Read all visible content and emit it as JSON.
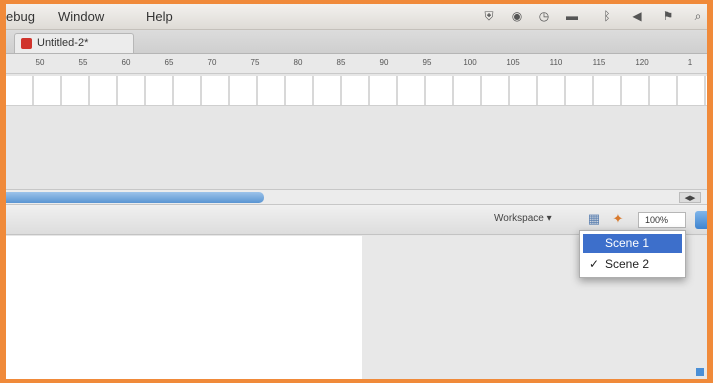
{
  "menubar": {
    "items": [
      "ebug",
      "Window",
      "Help"
    ]
  },
  "document_tab": {
    "label": "Untitled-2*"
  },
  "timeline": {
    "ruler_ticks": [
      "50",
      "55",
      "60",
      "65",
      "70",
      "75",
      "80",
      "85",
      "90",
      "95",
      "100",
      "105",
      "110",
      "115",
      "120",
      "1"
    ]
  },
  "stage_toolbar": {
    "workspace_label": "Workspace ▾",
    "zoom_value": "100%"
  },
  "scene_menu": {
    "items": [
      {
        "label": "Scene 1",
        "checked": false,
        "highlighted": true
      },
      {
        "label": "Scene 2",
        "checked": true,
        "highlighted": false
      }
    ],
    "check_glyph": "✓"
  },
  "colors": {
    "window_border": "#f08a3a",
    "selection_blue": "#3d6fcb",
    "scroll_thumb": "#5a95d2"
  }
}
